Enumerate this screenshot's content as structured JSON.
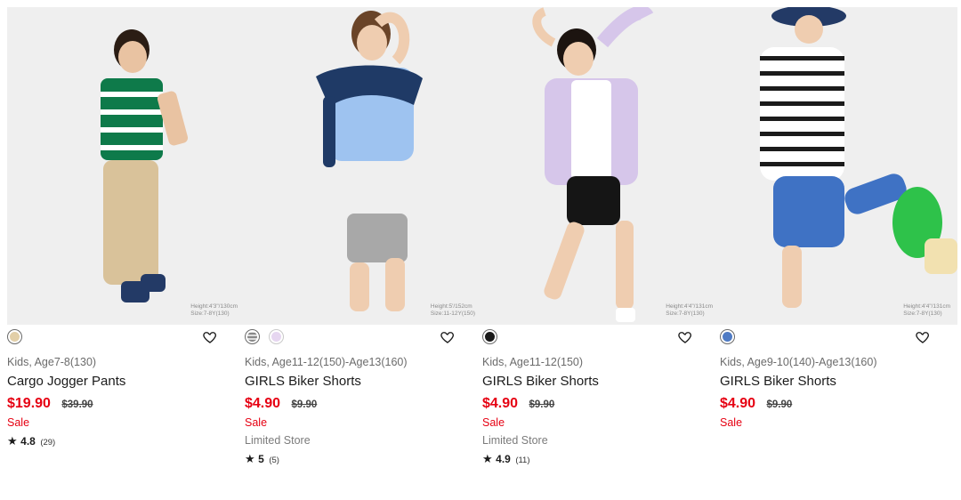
{
  "products": [
    {
      "photo_height": "Height:4'3\"/130cm",
      "photo_size": "Size:7-8Y(130)",
      "swatches": [
        {
          "color": "#e2cfa8",
          "pattern": "solid"
        }
      ],
      "age": "Kids, Age7-8(130)",
      "name": "Cargo Jogger Pants",
      "price": "$19.90",
      "old_price": "$39.90",
      "sale": "Sale",
      "limited": "",
      "rating": "4.8",
      "reviews": "(29)"
    },
    {
      "photo_height": "Height:5'/152cm",
      "photo_size": "Size:11-12Y(150)",
      "swatches": [
        {
          "color": "#7a7a7a",
          "pattern": "check"
        },
        {
          "color": "#e6d6f0",
          "pattern": "solid"
        }
      ],
      "age": "Kids, Age11-12(150)-Age13(160)",
      "name": "GIRLS Biker Shorts",
      "price": "$4.90",
      "old_price": "$9.90",
      "sale": "Sale",
      "limited": "Limited Store",
      "rating": "5",
      "reviews": "(5)"
    },
    {
      "photo_height": "Height:4'4\"/131cm",
      "photo_size": "Size:7-8Y(130)",
      "swatches": [
        {
          "color": "#1a1a1a",
          "pattern": "solid"
        }
      ],
      "age": "Kids, Age11-12(150)",
      "name": "GIRLS Biker Shorts",
      "price": "$4.90",
      "old_price": "$9.90",
      "sale": "Sale",
      "limited": "Limited Store",
      "rating": "4.9",
      "reviews": "(11)"
    },
    {
      "photo_height": "Height:4'4\"/131cm",
      "photo_size": "Size:7-8Y(130)",
      "swatches": [
        {
          "color": "#4f7bc4",
          "pattern": "solid"
        }
      ],
      "age": "Kids, Age9-10(140)-Age13(160)",
      "name": "GIRLS Biker Shorts",
      "price": "$4.90",
      "old_price": "$9.90",
      "sale": "Sale",
      "limited": "",
      "rating": "",
      "reviews": ""
    }
  ],
  "icons": {
    "wishlist": "heart-icon",
    "rating": "star-icon"
  },
  "colors": {
    "sale_red": "#e60012",
    "photo_bg": "#efefef"
  }
}
